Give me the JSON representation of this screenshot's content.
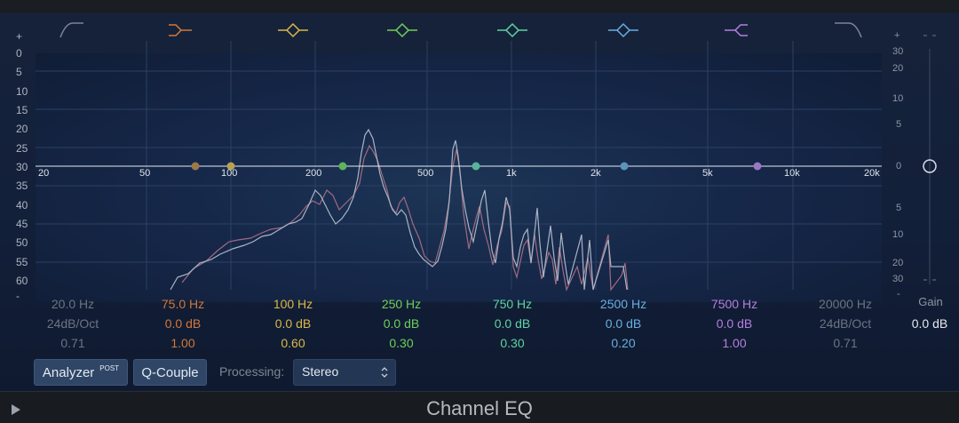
{
  "left_scale": [
    "+",
    "0",
    "5",
    "10",
    "15",
    "20",
    "25",
    "30",
    "35",
    "40",
    "45",
    "50",
    "55",
    "60",
    "-"
  ],
  "right_scale_top": [
    "+",
    "30",
    "20",
    "10",
    "5",
    "0",
    "5",
    "10",
    "20",
    "30",
    "-"
  ],
  "freq_labels": [
    "20",
    "50",
    "100",
    "200",
    "500",
    "1k",
    "2k",
    "5k",
    "10k",
    "20k"
  ],
  "bands": [
    {
      "freq": "20.0 Hz",
      "gain": "24dB/Oct",
      "q": "0.71",
      "color": "#6b7482",
      "icon": "low-cut-icon"
    },
    {
      "freq": "75.0 Hz",
      "gain": "0.0 dB",
      "q": "1.00",
      "color": "#d2773a",
      "icon": "low-shelf-icon"
    },
    {
      "freq": "100 Hz",
      "gain": "0.0 dB",
      "q": "0.60",
      "color": "#d9b84a",
      "icon": "bell-icon"
    },
    {
      "freq": "250 Hz",
      "gain": "0.0 dB",
      "q": "0.30",
      "color": "#6fcf59",
      "icon": "bell-icon"
    },
    {
      "freq": "750 Hz",
      "gain": "0.0 dB",
      "q": "0.30",
      "color": "#5ed3a2",
      "icon": "bell-icon"
    },
    {
      "freq": "2500 Hz",
      "gain": "0.0 dB",
      "q": "0.20",
      "color": "#69aee0",
      "icon": "bell-icon"
    },
    {
      "freq": "7500 Hz",
      "gain": "0.0 dB",
      "q": "1.00",
      "color": "#b47fe0",
      "icon": "high-shelf-icon"
    },
    {
      "freq": "20000 Hz",
      "gain": "24dB/Oct",
      "q": "0.71",
      "color": "#6b7482",
      "icon": "high-cut-icon"
    }
  ],
  "gain": {
    "label": "Gain",
    "value": "0.0 dB"
  },
  "controls": {
    "analyzer_label": "Analyzer",
    "analyzer_badge": "POST",
    "qcouple_label": "Q-Couple",
    "processing_label": "Processing:",
    "processing_value": "Stereo"
  },
  "footer": {
    "title": "Channel EQ",
    "play_icon": "play-icon"
  }
}
